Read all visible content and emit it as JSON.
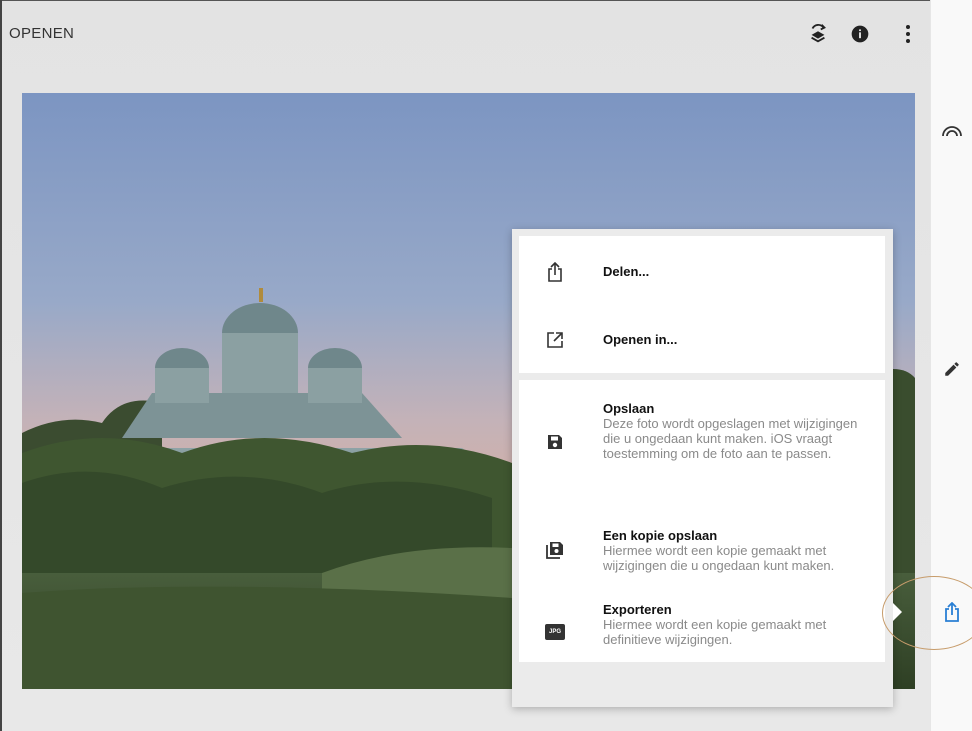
{
  "topbar": {
    "title": "OPENEN",
    "icons": [
      "layers-swap-icon",
      "info-icon",
      "more-vert-icon"
    ]
  },
  "rail": {
    "icons": [
      "looks-icon",
      "edit-pencil-icon",
      "share-export-icon"
    ]
  },
  "export_menu": {
    "share": {
      "label": "Delen...",
      "icon": "share-icon"
    },
    "open_in": {
      "label": "Openen in...",
      "icon": "open-in-new-icon"
    },
    "save": {
      "label": "Opslaan",
      "description": "Deze foto wordt opgeslagen met wijzigingen die u ongedaan kunt maken. iOS vraagt toestemming om de foto aan te passen.",
      "icon": "save-icon"
    },
    "save_copy": {
      "label": "Een kopie opslaan",
      "description": "Hiermee wordt een kopie gemaakt met wijzigingen die u ongedaan kunt maken.",
      "icon": "save-copy-icon"
    },
    "export": {
      "label": "Exporteren",
      "description": "Hiermee wordt een kopie gemaakt met definitieve wijzigingen.",
      "icon": "jpg-icon",
      "icon_text": "JPG"
    }
  },
  "colors": {
    "accent": "#2a7fd4",
    "highlight_ring": "#c79c6b"
  }
}
